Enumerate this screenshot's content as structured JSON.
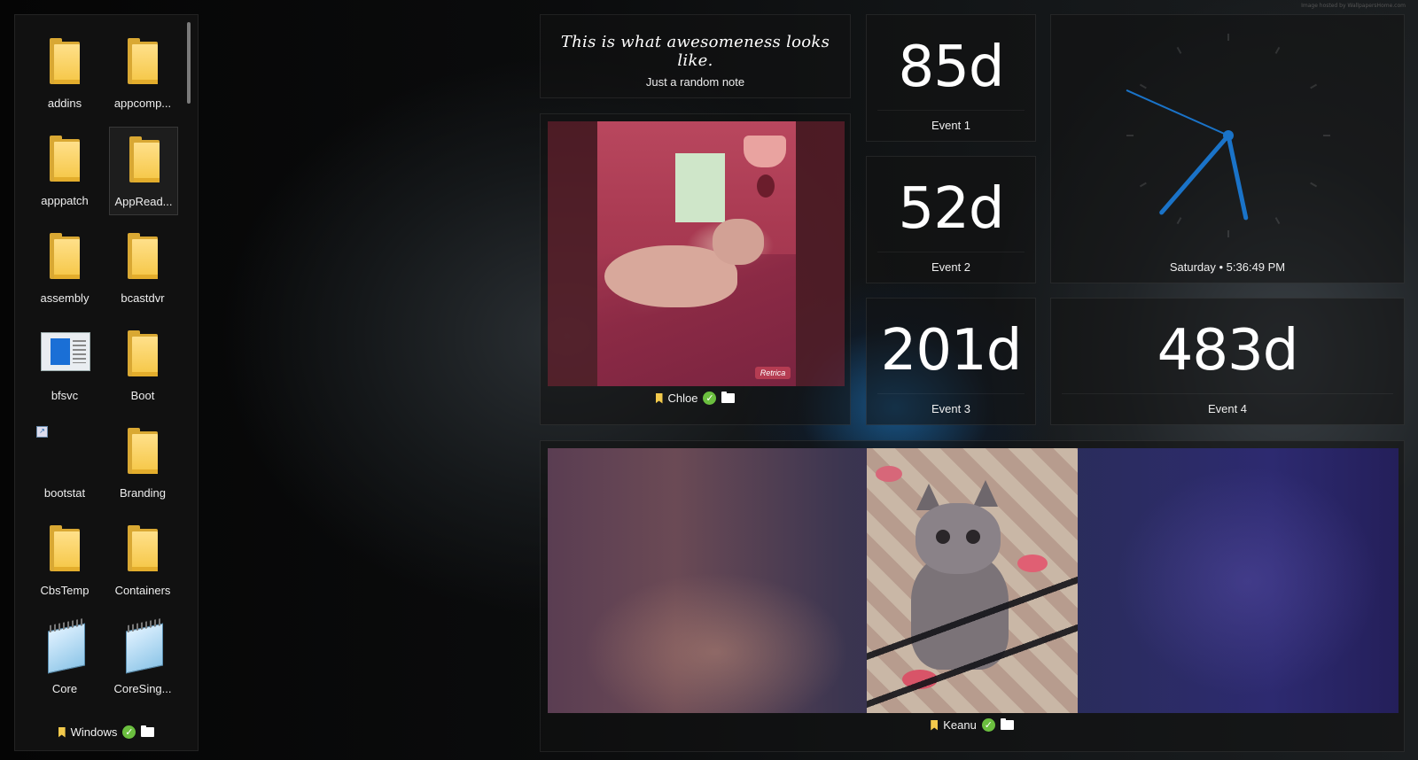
{
  "watermark": "Image hosted by WallpapersHome.com",
  "fence": {
    "title": "Windows",
    "items": [
      {
        "label": "addins",
        "icon": "folder-icon"
      },
      {
        "label": "appcomp...",
        "icon": "folder-icon"
      },
      {
        "label": "apppatch",
        "icon": "folder-icon"
      },
      {
        "label": "AppRead...",
        "icon": "folder-icon"
      },
      {
        "label": "assembly",
        "icon": "folder-icon"
      },
      {
        "label": "bcastdvr",
        "icon": "folder-icon"
      },
      {
        "label": "bfsvc",
        "icon": "application-icon"
      },
      {
        "label": "Boot",
        "icon": "folder-icon"
      },
      {
        "label": "bootstat",
        "icon": "shortcut-icon"
      },
      {
        "label": "Branding",
        "icon": "folder-icon"
      },
      {
        "label": "CbsTemp",
        "icon": "folder-icon"
      },
      {
        "label": "Containers",
        "icon": "folder-icon"
      },
      {
        "label": "Core",
        "icon": "notepad-icon"
      },
      {
        "label": "CoreSing...",
        "icon": "notepad-icon"
      }
    ]
  },
  "note": {
    "quote": "This is what awesomeness looks like.",
    "title": "Just a random note"
  },
  "countdowns": [
    {
      "value": "85d",
      "label": "Event 1"
    },
    {
      "value": "52d",
      "label": "Event 2"
    },
    {
      "value": "201d",
      "label": "Event 3"
    },
    {
      "value": "483d",
      "label": "Event 4"
    }
  ],
  "clock": {
    "text": "Saturday • 5:36:49 PM",
    "hour": 5,
    "minute": 36,
    "second": 49,
    "hand_color": "#1a73c8"
  },
  "photos": [
    {
      "caption": "Chloe",
      "watermark": "Retrica"
    },
    {
      "caption": "Keanu"
    }
  ],
  "colors": {
    "accent": "#1a73c8",
    "check": "#6bbf3f",
    "pin": "#f2c94c"
  }
}
